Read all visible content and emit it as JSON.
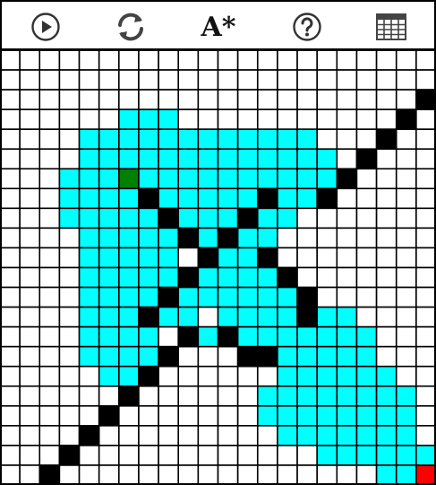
{
  "toolbar": {
    "play": {
      "icon": "play-icon"
    },
    "reset": {
      "icon": "refresh-icon"
    },
    "algorithm": {
      "label": "A*"
    },
    "help": {
      "icon": "help-icon"
    },
    "grid": {
      "icon": "grid-table-icon"
    }
  },
  "grid": {
    "cols": 22,
    "rows": 22,
    "colors": {
      "empty": "#ffffff",
      "visited": "#00ffff",
      "wall": "#000000",
      "start": "#008000",
      "goal": "#ff0000",
      "line": "#000000"
    },
    "visited": [
      [
        3,
        6
      ],
      [
        3,
        7
      ],
      [
        3,
        8
      ],
      [
        4,
        4
      ],
      [
        4,
        5
      ],
      [
        4,
        6
      ],
      [
        4,
        7
      ],
      [
        4,
        8
      ],
      [
        4,
        9
      ],
      [
        4,
        10
      ],
      [
        4,
        11
      ],
      [
        4,
        12
      ],
      [
        4,
        13
      ],
      [
        4,
        14
      ],
      [
        4,
        15
      ],
      [
        5,
        4
      ],
      [
        5,
        5
      ],
      [
        5,
        6
      ],
      [
        5,
        7
      ],
      [
        5,
        8
      ],
      [
        5,
        9
      ],
      [
        5,
        10
      ],
      [
        5,
        11
      ],
      [
        5,
        12
      ],
      [
        5,
        13
      ],
      [
        5,
        14
      ],
      [
        5,
        15
      ],
      [
        5,
        16
      ],
      [
        6,
        3
      ],
      [
        6,
        4
      ],
      [
        6,
        5
      ],
      [
        6,
        7
      ],
      [
        6,
        8
      ],
      [
        6,
        9
      ],
      [
        6,
        10
      ],
      [
        6,
        11
      ],
      [
        6,
        12
      ],
      [
        6,
        13
      ],
      [
        6,
        14
      ],
      [
        6,
        15
      ],
      [
        6,
        16
      ],
      [
        7,
        3
      ],
      [
        7,
        4
      ],
      [
        7,
        5
      ],
      [
        7,
        6
      ],
      [
        7,
        8
      ],
      [
        7,
        9
      ],
      [
        7,
        10
      ],
      [
        7,
        11
      ],
      [
        7,
        12
      ],
      [
        7,
        14
      ],
      [
        7,
        15
      ],
      [
        8,
        3
      ],
      [
        8,
        4
      ],
      [
        8,
        5
      ],
      [
        8,
        6
      ],
      [
        8,
        7
      ],
      [
        8,
        9
      ],
      [
        8,
        10
      ],
      [
        8,
        11
      ],
      [
        8,
        13
      ],
      [
        8,
        14
      ],
      [
        9,
        4
      ],
      [
        9,
        5
      ],
      [
        9,
        6
      ],
      [
        9,
        7
      ],
      [
        9,
        8
      ],
      [
        9,
        10
      ],
      [
        9,
        12
      ],
      [
        9,
        13
      ],
      [
        10,
        4
      ],
      [
        10,
        5
      ],
      [
        10,
        6
      ],
      [
        10,
        7
      ],
      [
        10,
        8
      ],
      [
        10,
        11
      ],
      [
        10,
        12
      ],
      [
        11,
        4
      ],
      [
        11,
        5
      ],
      [
        11,
        6
      ],
      [
        11,
        7
      ],
      [
        11,
        8
      ],
      [
        11,
        10
      ],
      [
        11,
        11
      ],
      [
        11,
        12
      ],
      [
        11,
        13
      ],
      [
        12,
        4
      ],
      [
        12,
        5
      ],
      [
        12,
        6
      ],
      [
        12,
        7
      ],
      [
        12,
        9
      ],
      [
        12,
        10
      ],
      [
        12,
        11
      ],
      [
        12,
        12
      ],
      [
        12,
        13
      ],
      [
        12,
        14
      ],
      [
        13,
        4
      ],
      [
        13,
        5
      ],
      [
        13,
        6
      ],
      [
        13,
        8
      ],
      [
        13,
        9
      ],
      [
        13,
        11
      ],
      [
        13,
        12
      ],
      [
        13,
        13
      ],
      [
        13,
        14
      ],
      [
        13,
        16
      ],
      [
        13,
        17
      ],
      [
        14,
        4
      ],
      [
        14,
        5
      ],
      [
        14,
        6
      ],
      [
        14,
        7
      ],
      [
        14,
        10
      ],
      [
        14,
        12
      ],
      [
        14,
        13
      ],
      [
        14,
        14
      ],
      [
        14,
        15
      ],
      [
        14,
        16
      ],
      [
        14,
        17
      ],
      [
        14,
        18
      ],
      [
        15,
        4
      ],
      [
        15,
        5
      ],
      [
        15,
        6
      ],
      [
        15,
        7
      ],
      [
        15,
        14
      ],
      [
        15,
        15
      ],
      [
        15,
        16
      ],
      [
        15,
        17
      ],
      [
        15,
        18
      ],
      [
        16,
        5
      ],
      [
        16,
        6
      ],
      [
        16,
        14
      ],
      [
        16,
        15
      ],
      [
        16,
        16
      ],
      [
        16,
        17
      ],
      [
        16,
        18
      ],
      [
        16,
        19
      ],
      [
        17,
        13
      ],
      [
        17,
        14
      ],
      [
        17,
        15
      ],
      [
        17,
        16
      ],
      [
        17,
        17
      ],
      [
        17,
        18
      ],
      [
        17,
        19
      ],
      [
        17,
        20
      ],
      [
        18,
        13
      ],
      [
        18,
        14
      ],
      [
        18,
        15
      ],
      [
        18,
        16
      ],
      [
        18,
        17
      ],
      [
        18,
        18
      ],
      [
        18,
        19
      ],
      [
        18,
        20
      ],
      [
        19,
        14
      ],
      [
        19,
        15
      ],
      [
        19,
        16
      ],
      [
        19,
        17
      ],
      [
        19,
        18
      ],
      [
        19,
        19
      ],
      [
        19,
        20
      ],
      [
        20,
        16
      ],
      [
        20,
        17
      ],
      [
        20,
        18
      ],
      [
        20,
        19
      ],
      [
        20,
        20
      ],
      [
        20,
        21
      ],
      [
        21,
        19
      ],
      [
        21,
        20
      ]
    ],
    "walls": [
      [
        2,
        21
      ],
      [
        3,
        20
      ],
      [
        4,
        19
      ],
      [
        5,
        18
      ],
      [
        6,
        17
      ],
      [
        7,
        16
      ],
      [
        7,
        7
      ],
      [
        8,
        8
      ],
      [
        9,
        9
      ],
      [
        10,
        10
      ],
      [
        11,
        9
      ],
      [
        12,
        8
      ],
      [
        13,
        7
      ],
      [
        14,
        9
      ],
      [
        15,
        8
      ],
      [
        16,
        7
      ],
      [
        7,
        13
      ],
      [
        8,
        12
      ],
      [
        9,
        11
      ],
      [
        10,
        13
      ],
      [
        11,
        14
      ],
      [
        12,
        15
      ],
      [
        13,
        15
      ],
      [
        14,
        11
      ],
      [
        15,
        12
      ],
      [
        15,
        13
      ],
      [
        17,
        6
      ],
      [
        18,
        5
      ],
      [
        19,
        4
      ],
      [
        20,
        3
      ],
      [
        21,
        2
      ]
    ],
    "start": [
      6,
      6
    ],
    "goal": [
      21,
      21
    ]
  }
}
